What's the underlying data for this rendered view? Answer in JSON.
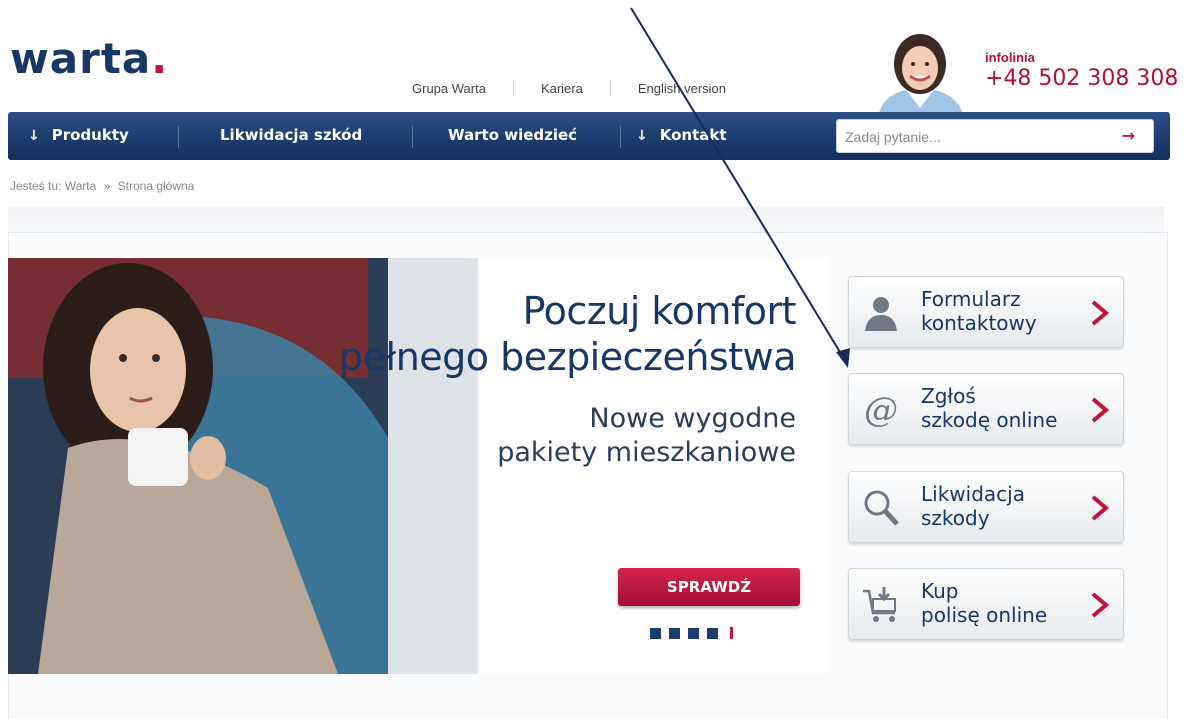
{
  "logo": {
    "text": "warta",
    "dot": "."
  },
  "top_links": [
    "Grupa Warta",
    "Kariera",
    "English version"
  ],
  "infolinia": {
    "label": "infolinia",
    "phone": "+48 502 308 308"
  },
  "nav": {
    "items": [
      {
        "label": "Produkty",
        "arrow": "↓"
      },
      {
        "label": "Likwidacja szkód"
      },
      {
        "label": "Warto wiedzieć"
      },
      {
        "label": "Kontakt",
        "arrow": "↓"
      }
    ]
  },
  "search": {
    "placeholder": "Zadaj pytanie...",
    "go_icon": "→"
  },
  "breadcrumb": {
    "prefix": "Jesteś tu:",
    "items": [
      "Warta",
      "Strona główna"
    ],
    "separator": "»"
  },
  "banner": {
    "headline_1": "Poczuj komfort",
    "headline_2": "pełnego bezpieczeństwa",
    "sub_1": "Nowe wygodne",
    "sub_2": "pakiety mieszkaniowe",
    "cta": "SPRAWDŹ"
  },
  "quick_buttons": [
    {
      "line1": "Formularz",
      "line2": "kontaktowy",
      "icon": "person-icon"
    },
    {
      "line1": "Zgłoś",
      "line2": "szkodę online",
      "icon": "at-icon"
    },
    {
      "line1": "Likwidacja",
      "line2": "szkody",
      "icon": "magnifier-icon"
    },
    {
      "line1": "Kup",
      "line2": "polisę online",
      "icon": "cart-icon"
    }
  ],
  "colors": {
    "brand_navy": "#173766",
    "brand_red": "#c0143c"
  }
}
